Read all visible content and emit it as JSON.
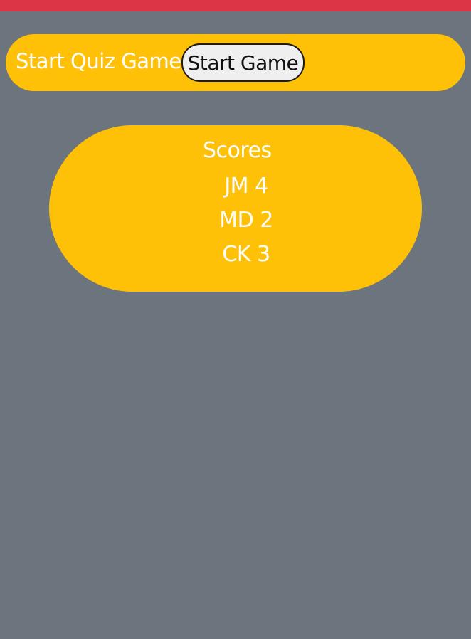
{
  "colors": {
    "background": "#6c757d",
    "top_bar": "#dc3545",
    "panel": "#ffc107",
    "text": "#ffffff"
  },
  "start_section": {
    "title": "Start Quiz Game",
    "button_label": "Start Game"
  },
  "scores": {
    "title": "Scores",
    "items": [
      "JM 4",
      "MD 2",
      "CK 3"
    ]
  }
}
